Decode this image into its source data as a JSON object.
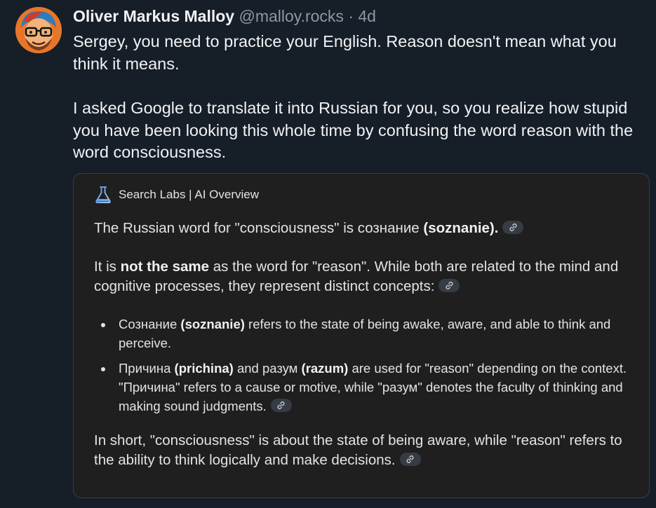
{
  "post": {
    "author": "Oliver Markus Malloy",
    "handle": "@malloy.rocks",
    "separator": "·",
    "time": "4d",
    "paragraph1": "Sergey, you need to practice your English. Reason doesn't mean what you think it means.",
    "paragraph2": "I asked Google to translate it into Russian for you, so you realize how stupid you have been looking this whole time by confusing the word reason with the word consciousness."
  },
  "overview": {
    "title": "Search Labs | AI Overview",
    "p1_pre": "The Russian word for \"consciousness\" is сознание ",
    "p1_bold": "(soznanie).",
    "p2_pre": "It is ",
    "p2_bold": "not the same",
    "p2_post": " as the word for \"reason\". While both are related to the mind and cognitive processes, they represent distinct concepts:",
    "b1_pre": "Сознание ",
    "b1_bold": "(soznanie)",
    "b1_post": " refers to the state of being awake, aware, and able to think and perceive.",
    "b2_a": "Причина ",
    "b2_bold1": "(prichina)",
    "b2_b": " and разум ",
    "b2_bold2": "(razum)",
    "b2_c": " are used for \"reason\" depending on the context. \"Причина\" refers to a cause or motive, while \"разум\" denotes the faculty of thinking and making sound judgments.",
    "p4": "In short, \"consciousness\" is about the state of being aware, while \"reason\" refers to the ability to think logically and make decisions."
  },
  "icons": {
    "avatar": "avatar-cartoon",
    "flask": "labs-flask-icon",
    "link": "link-icon"
  },
  "colors": {
    "background": "#161e27",
    "embed_background": "#1f1f1f",
    "muted": "#8b98a5",
    "accent": "#4a90e2"
  }
}
